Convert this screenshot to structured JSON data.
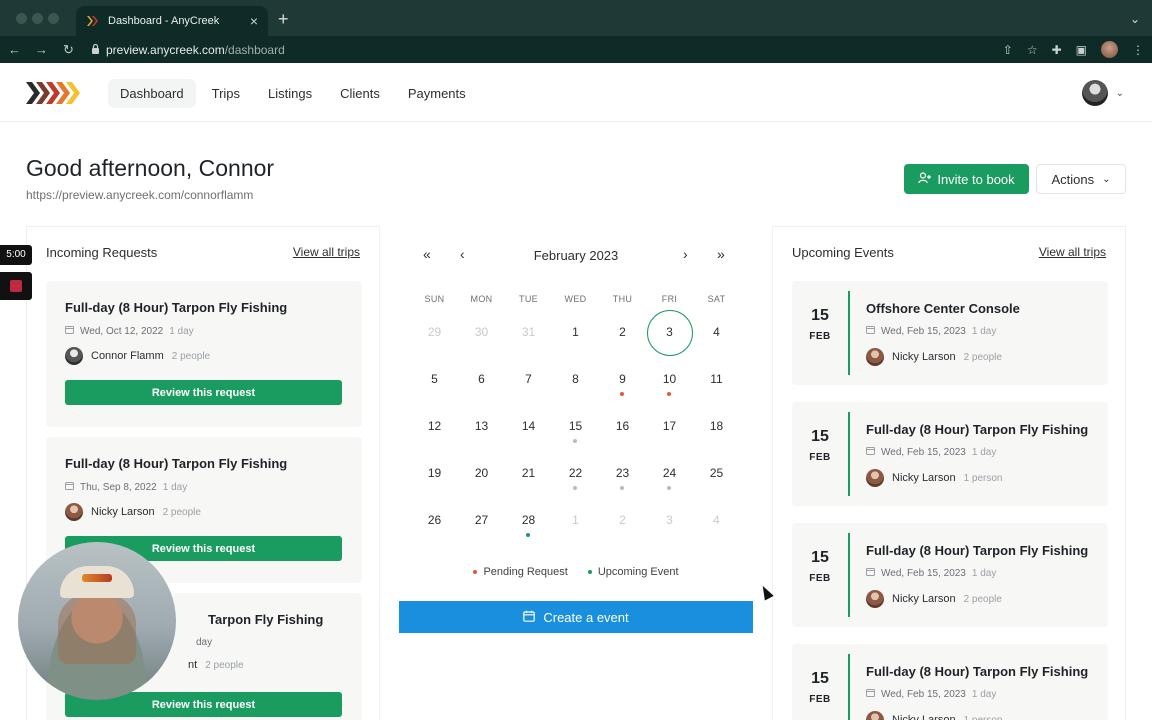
{
  "browser": {
    "tab_title": "Dashboard - AnyCreek",
    "url_host": "preview.anycreek.com",
    "url_path": "/dashboard"
  },
  "nav": {
    "items": [
      "Dashboard",
      "Trips",
      "Listings",
      "Clients",
      "Payments"
    ],
    "active": "Dashboard"
  },
  "header": {
    "greeting": "Good afternoon, Connor",
    "profile_url": "https://preview.anycreek.com/connorflamm",
    "invite_label": "Invite to book",
    "actions_label": "Actions"
  },
  "incoming": {
    "title": "Incoming Requests",
    "link": "View all trips",
    "requests": [
      {
        "title": "Full-day (8 Hour) Tarpon Fly Fishing",
        "date": "Wed, Oct 12, 2022",
        "duration": "1 day",
        "person": "Connor Flamm",
        "people": "2 people",
        "button": "Review this request"
      },
      {
        "title": "Full-day (8 Hour) Tarpon Fly Fishing",
        "date": "Thu, Sep 8, 2022",
        "duration": "1 day",
        "person": "Nicky Larson",
        "people": "2 people",
        "button": "Review this request"
      },
      {
        "title": "Tarpon Fly Fishing",
        "date": "",
        "duration": "day",
        "person": "nt",
        "people": "2 people",
        "button": "Review this request"
      }
    ]
  },
  "calendar": {
    "prev_year": "«",
    "prev_month": "‹",
    "next_month": "›",
    "next_year": "»",
    "month": "February 2023",
    "weekdays": [
      "SUN",
      "MON",
      "TUE",
      "WED",
      "THU",
      "FRI",
      "SAT"
    ],
    "weeks": [
      [
        {
          "d": "29",
          "m": true
        },
        {
          "d": "30",
          "m": true
        },
        {
          "d": "31",
          "m": true
        },
        {
          "d": "1"
        },
        {
          "d": "2"
        },
        {
          "d": "3",
          "today": true
        },
        {
          "d": "4"
        }
      ],
      [
        {
          "d": "5"
        },
        {
          "d": "6"
        },
        {
          "d": "7"
        },
        {
          "d": "8"
        },
        {
          "d": "9",
          "dot": "pending"
        },
        {
          "d": "10",
          "dot": "pending"
        },
        {
          "d": "11"
        }
      ],
      [
        {
          "d": "12"
        },
        {
          "d": "13"
        },
        {
          "d": "14"
        },
        {
          "d": "15",
          "dot": "upcoming"
        },
        {
          "d": "16"
        },
        {
          "d": "17"
        },
        {
          "d": "18"
        }
      ],
      [
        {
          "d": "19"
        },
        {
          "d": "20"
        },
        {
          "d": "21"
        },
        {
          "d": "22",
          "dot": "upcoming"
        },
        {
          "d": "23",
          "dot": "upcoming"
        },
        {
          "d": "24",
          "dot": "upcoming"
        },
        {
          "d": "25"
        }
      ],
      [
        {
          "d": "26"
        },
        {
          "d": "27"
        },
        {
          "d": "28",
          "dot": "teal"
        },
        {
          "d": "1",
          "m": true
        },
        {
          "d": "2",
          "m": true
        },
        {
          "d": "3",
          "m": true
        },
        {
          "d": "4",
          "m": true
        }
      ]
    ],
    "legend": {
      "pending": "Pending Request",
      "upcoming": "Upcoming Event"
    },
    "create_label": "Create a event",
    "colors": {
      "pending": "#e8553b",
      "upcoming": "#1a9b5f",
      "today": "#1a9b5f"
    }
  },
  "upcoming": {
    "title": "Upcoming Events",
    "link": "View all trips",
    "events": [
      {
        "day": "15",
        "month": "FEB",
        "title": "Offshore Center Console",
        "date": "Wed, Feb 15, 2023",
        "duration": "1 day",
        "person": "Nicky Larson",
        "people": "2 people"
      },
      {
        "day": "15",
        "month": "FEB",
        "title": "Full-day (8 Hour) Tarpon Fly Fishing",
        "date": "Wed, Feb 15, 2023",
        "duration": "1 day",
        "person": "Nicky Larson",
        "people": "1 person"
      },
      {
        "day": "15",
        "month": "FEB",
        "title": "Full-day (8 Hour) Tarpon Fly Fishing",
        "date": "Wed, Feb 15, 2023",
        "duration": "1 day",
        "person": "Nicky Larson",
        "people": "2 people"
      },
      {
        "day": "15",
        "month": "FEB",
        "title": "Full-day (8 Hour) Tarpon Fly Fishing",
        "date": "Wed, Feb 15, 2023",
        "duration": "1 day",
        "person": "Nicky Larson",
        "people": "1 person"
      }
    ]
  },
  "overlay": {
    "timer": "5:00"
  },
  "colors": {
    "primary_green": "#1a9b5f",
    "blue": "#1a8fde",
    "chrome": "#0f2b28"
  }
}
